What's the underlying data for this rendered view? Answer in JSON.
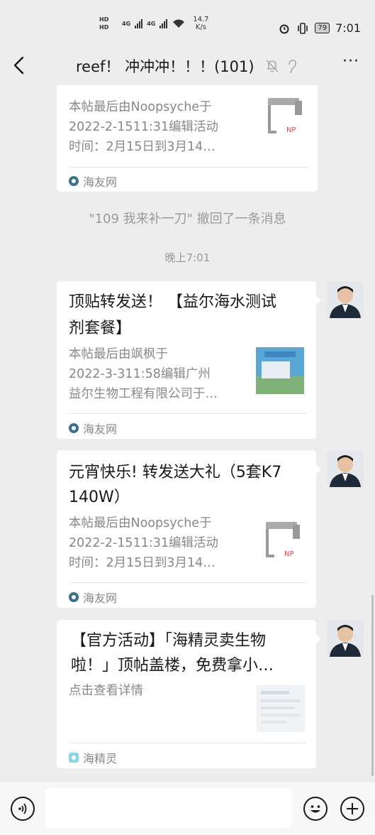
{
  "status_bar": {
    "hd1": "HD",
    "hd2": "HD",
    "net1": "4G",
    "net2": "4G",
    "speed_value": "14.7",
    "speed_unit": "K/s",
    "battery": "79",
    "time": "7:01"
  },
  "header": {
    "title": "reef！ 冲冲冲！！！(101)",
    "back_icon": "back-chevron-icon",
    "mute_icon": "bell-off-icon",
    "ear_icon": "earpiece-icon",
    "more_label": "···"
  },
  "messages": [
    {
      "type": "link_card",
      "title_partial": "",
      "desc_lines": [
        "本帖最后由Noopsyche于",
        "2022-2-1511:31编辑活动",
        "时间：2月15日到3月14…"
      ],
      "source": "海友网",
      "thumb": "lamp-product-image"
    },
    {
      "type": "system",
      "text": "\"109 我来补一刀\" 撤回了一条消息"
    },
    {
      "type": "time",
      "text": "晚上7:01"
    },
    {
      "type": "link_card",
      "title_lines": [
        "顶贴转发送！ 【益尔海水测试",
        "剂套餐】"
      ],
      "desc_lines": [
        "本帖最后由飒枫于",
        "2022-3-311:58编辑广州",
        "益尔生物工程有限公司于…"
      ],
      "source": "海友网",
      "thumb": "building-image"
    },
    {
      "type": "link_card",
      "title_lines": [
        "元宵快乐! 转发送大礼（5套K7",
        "140W）"
      ],
      "desc_lines": [
        "本帖最后由Noopsyche于",
        "2022-2-1511:31编辑活动",
        "时间：2月15日到3月14…"
      ],
      "source": "海友网",
      "thumb": "lamp-product-image"
    },
    {
      "type": "link_card",
      "title_lines": [
        "【官方活动】「海精灵卖生物",
        "啦！」顶帖盖楼，免费拿小…"
      ],
      "desc_lines": [
        "点击查看详情"
      ],
      "source": "海精灵",
      "thumb": "blurred-image"
    }
  ],
  "input_bar": {
    "voice_icon": "voice-icon",
    "emoji_icon": "emoji-icon",
    "plus_icon": "plus-icon",
    "text_value": ""
  }
}
